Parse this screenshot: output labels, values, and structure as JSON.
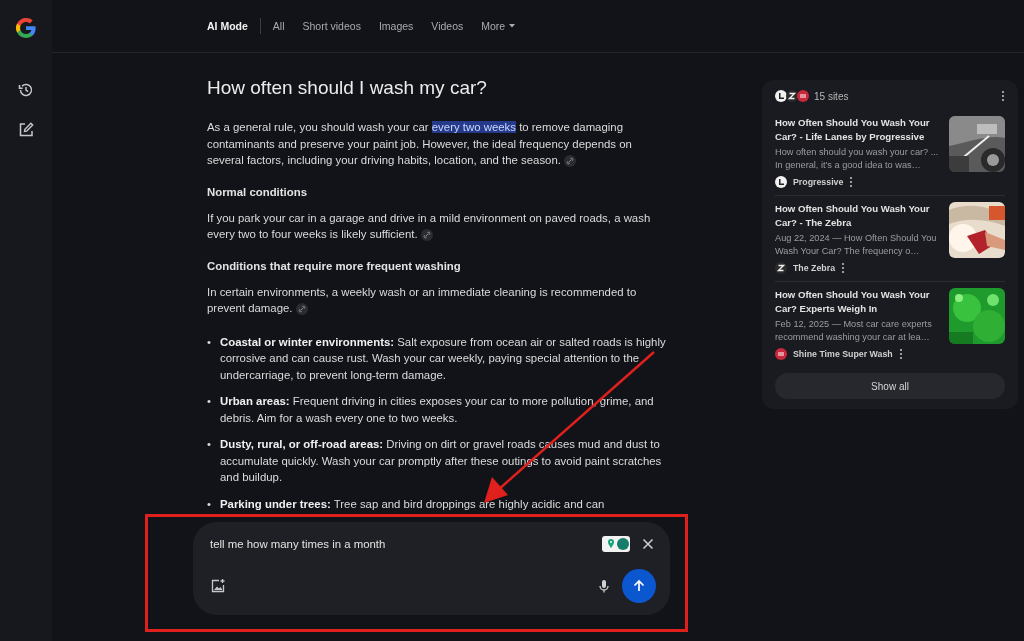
{
  "nav": {
    "tabs": [
      {
        "label": "AI Mode",
        "selected": true,
        "has_menu": false
      },
      {
        "label": "All",
        "selected": false,
        "has_menu": false
      },
      {
        "label": "Short videos",
        "selected": false,
        "has_menu": false
      },
      {
        "label": "Images",
        "selected": false,
        "has_menu": false
      },
      {
        "label": "Videos",
        "selected": false,
        "has_menu": false
      },
      {
        "label": "More",
        "selected": false,
        "has_menu": true
      }
    ]
  },
  "article": {
    "title": "How often should I wash my car?",
    "blocks": [
      {
        "kind": "paragraph",
        "citation": true,
        "segments": [
          {
            "text": "As a general rule, you should wash your car ",
            "highlighted": false
          },
          {
            "text": "every two weeks",
            "highlighted": true
          },
          {
            "text": " to remove damaging contaminants and preserve your paint job. However, the ideal frequency depends on several factors, including your driving habits, location, and the season.",
            "highlighted": false
          }
        ]
      },
      {
        "kind": "heading",
        "text": "Normal conditions"
      },
      {
        "kind": "paragraph",
        "citation": true,
        "segments": [
          {
            "text": "If you park your car in a garage and drive in a mild environment on paved roads, a wash every two to four weeks is likely sufficient.",
            "highlighted": false
          }
        ]
      },
      {
        "kind": "heading",
        "text": "Conditions that require more frequent washing"
      },
      {
        "kind": "paragraph",
        "citation": true,
        "segments": [
          {
            "text": "In certain environments, a weekly wash or an immediate cleaning is recommended to prevent damage.",
            "highlighted": false
          }
        ]
      },
      {
        "kind": "list",
        "marker": "•",
        "items": [
          "**Coastal or winter environments:** Salt exposure from ocean air or salted roads is highly corrosive and can cause rust. Wash your car weekly, paying special attention to the undercarriage, to prevent long-term damage.",
          "**Urban areas:** Frequent driving in cities exposes your car to more pollution, grime, and debris. Aim for a wash every one to two weeks.",
          "**Dusty, rural, or off-road areas:** Driving on dirt or gravel roads causes mud and dust to accumulate quickly. Wash your car promptly after these outings to avoid paint scratches and buildup.",
          "**Parking under trees:** Tree sap and bird droppings are highly acidic and can"
        ]
      }
    ]
  },
  "sources": {
    "count_label": "15 sites",
    "items": [
      {
        "title": "How Often Should You Wash Your Car? - Life Lanes by Progressive",
        "snippet": "How often should you wash your car? ... In general, it's a good idea to was…",
        "source": "Progressive"
      },
      {
        "title": "How Often Should You Wash Your Car? - The Zebra",
        "snippet": "Aug 22, 2024 — How Often Should You Wash Your Car? The frequency o…",
        "source": "The Zebra"
      },
      {
        "title": "How Often Should You Wash Your Car? Experts Weigh In",
        "snippet": "Feb 12, 2025 — Most car care experts recommend washing your car at lea…",
        "source": "Shine Time Super Wash"
      }
    ],
    "button": "Show all"
  },
  "prompt": {
    "value": "tell me how many times in a month"
  }
}
